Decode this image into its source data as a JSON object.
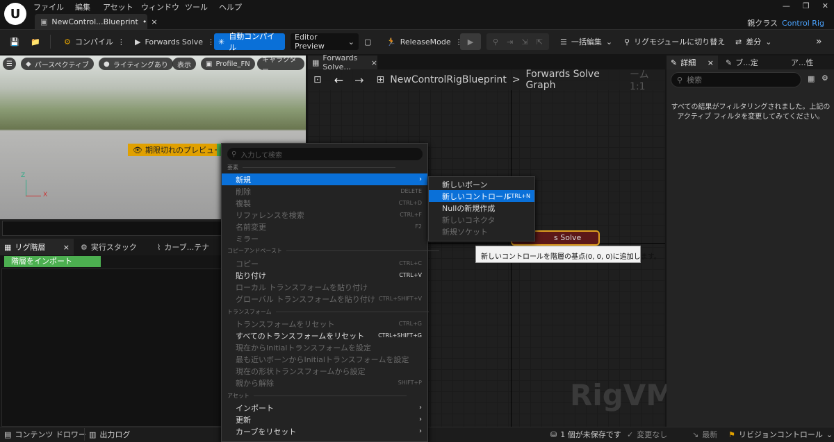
{
  "menubar": {
    "items": [
      "ファイル",
      "編集",
      "アセット",
      "ウィンドウ",
      "ツール",
      "ヘルプ"
    ],
    "doc_tab": "NewControl...Blueprint",
    "doc_tab_marker": "•",
    "parent_label": "親クラス",
    "parent_value": "Control Rig"
  },
  "toolbar": {
    "compile": "コンパイル",
    "forwards": "Forwards Solve",
    "auto_compile": "自動コンパイル",
    "preview": "Editor Preview",
    "release": "ReleaseMode",
    "bulk_edit": "一括編集",
    "rig_switch": "リグモジュールに切り替え",
    "diff": "差分"
  },
  "viewport": {
    "perspective": "パースペクティブ",
    "lighting": "ライティングあり",
    "show": "表示",
    "profile": "Profile_FN",
    "character": "キャラクター",
    "warning": "期限切れのプレビュー",
    "axis_z": "Z",
    "axis_x": "X"
  },
  "tree": {
    "tabs": [
      "リグ階層",
      "実行スタック",
      "カーブ...テナ"
    ],
    "import": "階層をインポート"
  },
  "graph": {
    "tab": "Forwards Solve...",
    "breadcrumb_root": "NewControlRigBlueprint",
    "breadcrumb_sep": ">",
    "breadcrumb_leaf": "Forwards Solve Graph",
    "zoom": "ーム 1:1",
    "node_label": "s Solve",
    "watermark": "RigVM",
    "tooltip": "新しいコントロールを階層の基点(0, 0, 0)に追加します。"
  },
  "details": {
    "tabs": [
      "詳細",
      "ブ...定",
      "ア...性"
    ],
    "search_placeholder": "検索",
    "message": "すべての結果がフィルタリングされました。上記のアクティブ フィルタを変更してみてください。"
  },
  "status": {
    "content_drawer": "コンテンツ ドロワー",
    "output_log": "出力ログ",
    "unsaved": "1 個が未保存です",
    "no_changes": "変更なし",
    "latest": "最新",
    "revision": "リビジョンコントロール"
  },
  "context_menu": {
    "search_placeholder": "入力して検索",
    "sections": {
      "elements": "要素",
      "copy_paste": "コピーアンドペースト",
      "transform": "トランスフォーム",
      "asset": "アセット"
    },
    "items": [
      {
        "label": "新規",
        "shortcut": "",
        "arrow": "›"
      },
      {
        "label": "削除",
        "shortcut": "DELETE"
      },
      {
        "label": "複製",
        "shortcut": "CTRL+D"
      },
      {
        "label": "リファレンスを検索",
        "shortcut": "CTRL+F"
      },
      {
        "label": "名前変更",
        "shortcut": "F2"
      },
      {
        "label": "ミラー",
        "shortcut": ""
      },
      {
        "label": "コピー",
        "shortcut": "CTRL+C"
      },
      {
        "label": "貼り付け",
        "shortcut": "CTRL+V"
      },
      {
        "label": "ローカル トランスフォームを貼り付け",
        "shortcut": ""
      },
      {
        "label": "グローバル トランスフォームを貼り付け",
        "shortcut": "CTRL+SHIFT+V"
      },
      {
        "label": "トランスフォームをリセット",
        "shortcut": "CTRL+G"
      },
      {
        "label": "すべてのトランスフォームをリセット",
        "shortcut": "CTRL+SHIFT+G"
      },
      {
        "label": "現在からInitialトランスフォームを設定",
        "shortcut": ""
      },
      {
        "label": "最も近いボーンからInitialトランスフォームを設定",
        "shortcut": ""
      },
      {
        "label": "現在の形状トランスフォームから設定",
        "shortcut": ""
      },
      {
        "label": "親から解除",
        "shortcut": "SHIFT+P"
      },
      {
        "label": "インポート",
        "shortcut": "",
        "arrow": "›"
      },
      {
        "label": "更新",
        "shortcut": "",
        "arrow": "›"
      },
      {
        "label": "カーブをリセット",
        "shortcut": "",
        "arrow": "›"
      }
    ]
  },
  "submenu": {
    "items": [
      {
        "label": "新しいボーン",
        "shortcut": ""
      },
      {
        "label": "新しいコントロール",
        "shortcut": "CTRL+N"
      },
      {
        "label": "Nullの新規作成",
        "shortcut": ""
      },
      {
        "label": "新しいコネクタ",
        "shortcut": ""
      },
      {
        "label": "新規ソケット",
        "shortcut": ""
      }
    ]
  }
}
